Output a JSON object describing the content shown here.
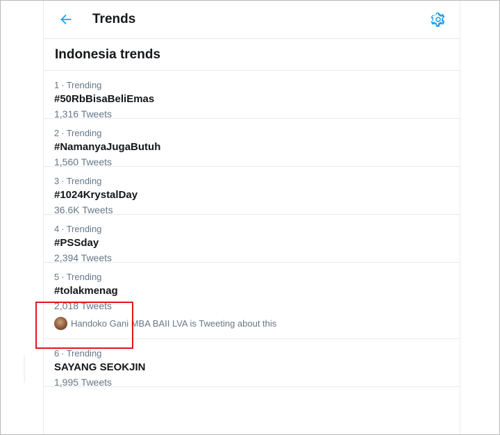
{
  "header": {
    "title": "Trends"
  },
  "section": {
    "heading": "Indonesia trends"
  },
  "trends": [
    {
      "rank": "1",
      "label": "Trending",
      "name": "#50RbBisaBeliEmas",
      "tweets": "1,316 Tweets"
    },
    {
      "rank": "2",
      "label": "Trending",
      "name": "#NamanyaJugaButuh",
      "tweets": "1,560 Tweets"
    },
    {
      "rank": "3",
      "label": "Trending",
      "name": "#1024KrystalDay",
      "tweets": "36.6K Tweets"
    },
    {
      "rank": "4",
      "label": "Trending",
      "name": "#PSSday",
      "tweets": "2,394 Tweets"
    },
    {
      "rank": "5",
      "label": "Trending",
      "name": "#tolakmenag",
      "tweets": "2,018 Tweets",
      "context": "Handoko Gani MBA BAII LVA is Tweeting about this"
    },
    {
      "rank": "6",
      "label": "Trending",
      "name": "SAYANG SEOKJIN",
      "tweets": "1,995 Tweets"
    }
  ],
  "colors": {
    "accent": "#1da1f2",
    "highlight": "#e0161d",
    "text_primary": "#14171a",
    "text_secondary": "#657786"
  },
  "icons": {
    "back": "arrow-left-icon",
    "settings": "gear-icon"
  }
}
